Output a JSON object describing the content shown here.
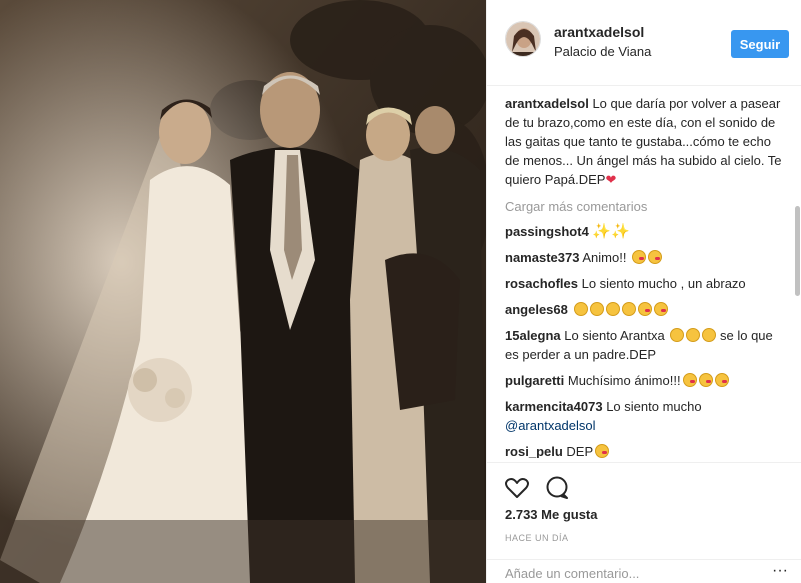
{
  "post": {
    "username": "arantxadelsol",
    "location": "Palacio de Viana",
    "follow_label": "Seguir",
    "caption_user": "arantxadelsol",
    "caption_text": "Lo que daría por volver a pasear de tu brazo,como en este día, con el sonido de las gaitas que tanto te gustaba...cómo te echo de menos... Un ángel más ha subido al cielo. Te quiero Papá.DEP",
    "load_more_label": "Cargar más comentarios",
    "likes": "2.733 Me gusta",
    "time_label": "HACE UN DÍA",
    "comment_placeholder": "Añade un comentario..."
  },
  "comments": [
    {
      "user": "passingshot4",
      "text": "",
      "emoji": "sparkles-x2"
    },
    {
      "user": "namaste373",
      "text": "Animo!!",
      "emoji": "wink-kiss-x2"
    },
    {
      "user": "rosachofles",
      "text": "Lo siento mucho , un abrazo",
      "emoji": ""
    },
    {
      "user": "angeles68",
      "text": "",
      "emoji": "sad-x4-wink-kiss-x2"
    },
    {
      "user": "15alegna",
      "text": "Lo siento Arantxa",
      "text2": "se lo que es perder a un padre.DEP",
      "emoji": "crying-x3"
    },
    {
      "user": "pulgaretti",
      "text": "Muchísimo ánimo!!!",
      "emoji": "wink-kiss-x3"
    },
    {
      "user": "karmencita4073",
      "text": "Lo siento mucho",
      "mention": "@arantxadelsol"
    },
    {
      "user": "rosi_pelu",
      "text": "DEP",
      "emoji": "wink-kiss"
    }
  ],
  "icons": {
    "like": "heart-icon",
    "comment": "comment-icon",
    "more": "more-options-icon"
  },
  "colors": {
    "accent": "#3897f0",
    "text": "#262626",
    "muted": "#999999"
  }
}
